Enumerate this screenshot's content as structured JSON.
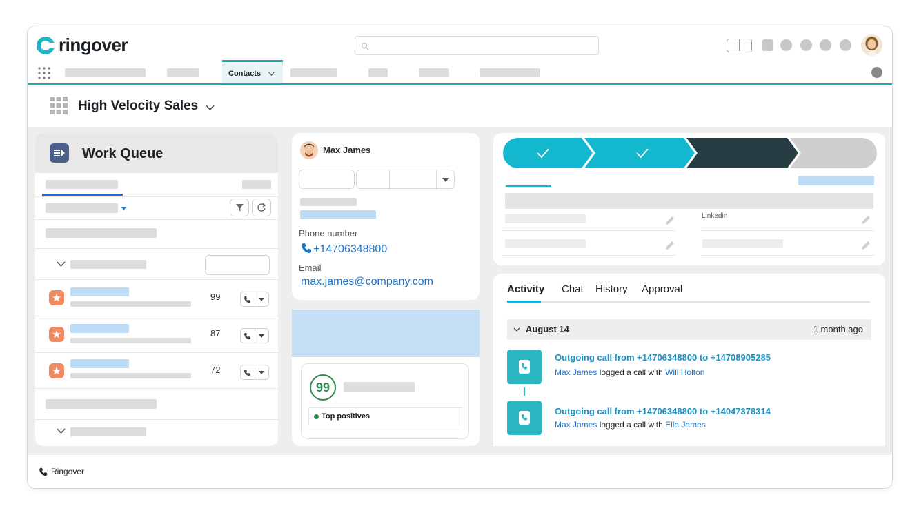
{
  "app": {
    "brand": "ringover"
  },
  "nav": {
    "active_tab": "Contacts"
  },
  "workspace": {
    "title": "High Velocity Sales"
  },
  "work_queue": {
    "title": "Work Queue",
    "rows": [
      {
        "score": "99"
      },
      {
        "score": "87"
      },
      {
        "score": "72"
      }
    ]
  },
  "contact": {
    "name": "Max James",
    "phone_label": "Phone number",
    "phone": "+14706348800",
    "email_label": "Email",
    "email": "max.james@company.com"
  },
  "score_card": {
    "score": "99",
    "top_positives": "Top positives"
  },
  "details": {
    "linkedin_label": "Linkedin"
  },
  "activity": {
    "tabs": [
      "Activity",
      "Chat",
      "History",
      "Approval"
    ],
    "group_date": "August 14",
    "group_relative": "1 month ago",
    "items": [
      {
        "title": "Outgoing call from +14706348800 to +14708905285",
        "actor": "Max James",
        "verb": "logged a call with",
        "target": "Will Holton"
      },
      {
        "title": "Outgoing call from +14706348800 to +14047378314",
        "actor": "Max James",
        "verb": "logged a call with",
        "target": "Ella James"
      }
    ]
  },
  "footer": {
    "label": "Ringover"
  },
  "colors": {
    "accent": "#1fa9a9",
    "pipeline_done": "#13b8cf",
    "pipeline_current": "#263d43",
    "pipeline_todo": "#cfcfcf",
    "link": "#1a73c9"
  }
}
